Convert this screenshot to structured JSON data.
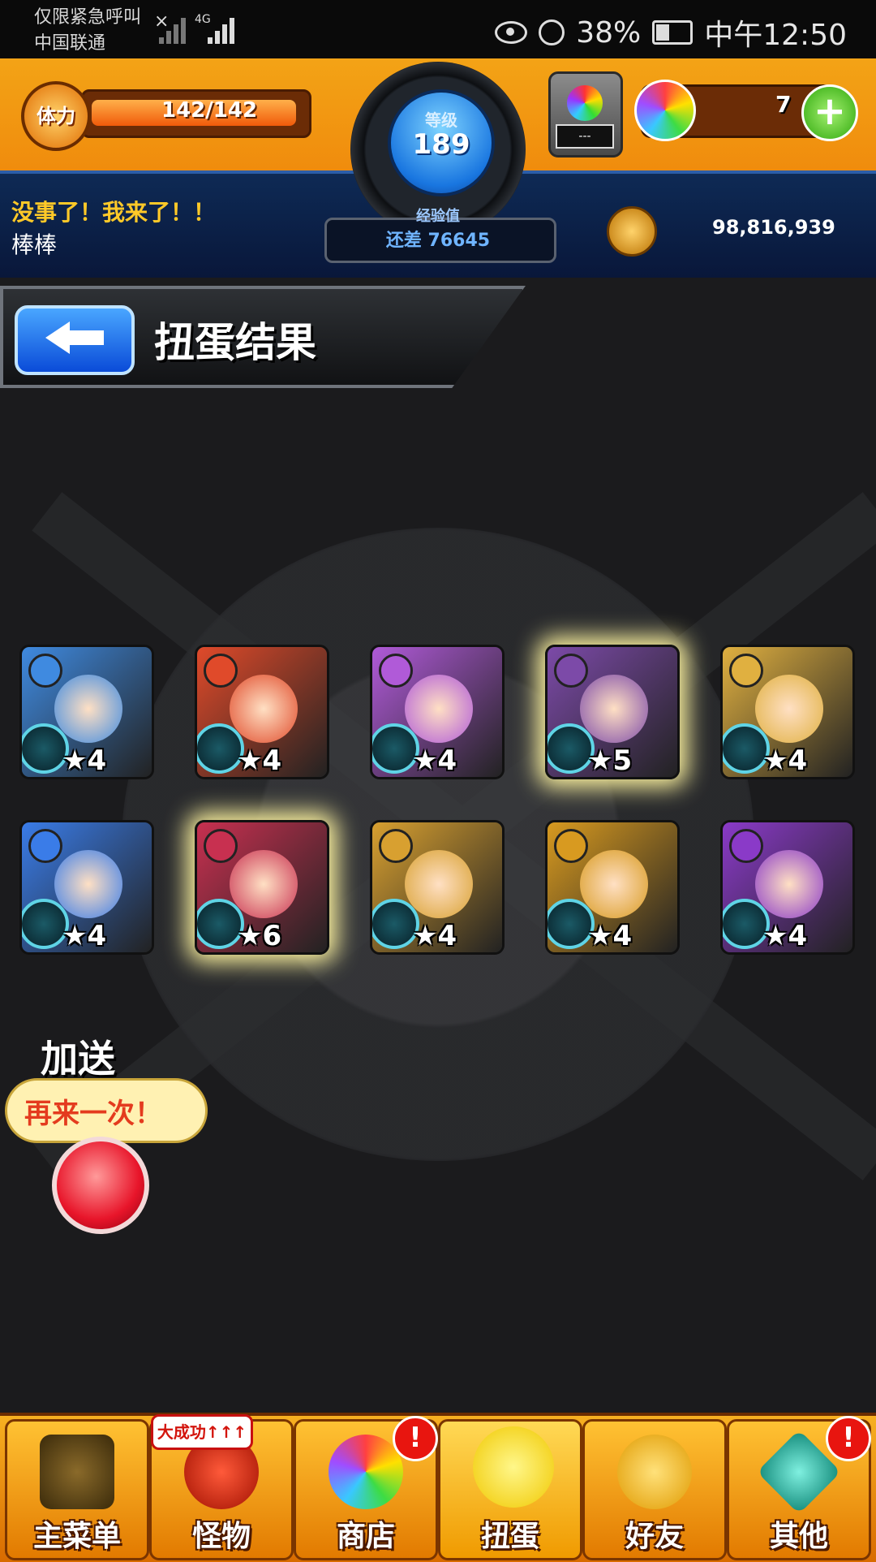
{
  "status_bar": {
    "carrier_line1": "仅限紧急呼叫",
    "carrier_line2": "中国联通",
    "network": "4G",
    "battery": "38%",
    "time": "中午12:50"
  },
  "hud": {
    "stamina_label": "体力",
    "stamina": "142/142",
    "stamina_fraction": 1.0,
    "level_label": "等级",
    "level": "189",
    "exp_label": "经验值",
    "exp_remaining": "还差 76645",
    "machine_display": "---",
    "gem_count": "7",
    "message": "没事了！我来了！！",
    "player_name": "棒棒",
    "coins": "98,816,939"
  },
  "page": {
    "title": "扭蛋结果"
  },
  "results": [
    {
      "stars": "★4",
      "element": "water",
      "color": "#3f8ae0",
      "glow": false
    },
    {
      "stars": "★4",
      "element": "fire",
      "color": "#e04a2a",
      "glow": false
    },
    {
      "stars": "★4",
      "element": "dark",
      "color": "#b05ad8",
      "glow": false
    },
    {
      "stars": "★5",
      "element": "dark",
      "color": "#7c4aa8",
      "glow": true
    },
    {
      "stars": "★4",
      "element": "light",
      "color": "#e0b040",
      "glow": false
    },
    {
      "stars": "★4",
      "element": "water",
      "color": "#3a7ce8",
      "glow": false
    },
    {
      "stars": "★6",
      "element": "fire",
      "color": "#c83050",
      "glow": true
    },
    {
      "stars": "★4",
      "element": "light",
      "color": "#d8a030",
      "glow": false
    },
    {
      "stars": "★4",
      "element": "light",
      "color": "#d89a20",
      "glow": false
    },
    {
      "stars": "★4",
      "element": "dark",
      "color": "#8a3ac8",
      "glow": false
    }
  ],
  "bonus": {
    "label": "加送",
    "bubble": "再来一次！"
  },
  "nav": {
    "main_menu": "主菜单",
    "monsters": "怪物",
    "monsters_promo": "大成功↑↑↑",
    "shop": "商店",
    "gacha": "扭蛋",
    "friends": "好友",
    "other": "其他",
    "alert": "!"
  }
}
